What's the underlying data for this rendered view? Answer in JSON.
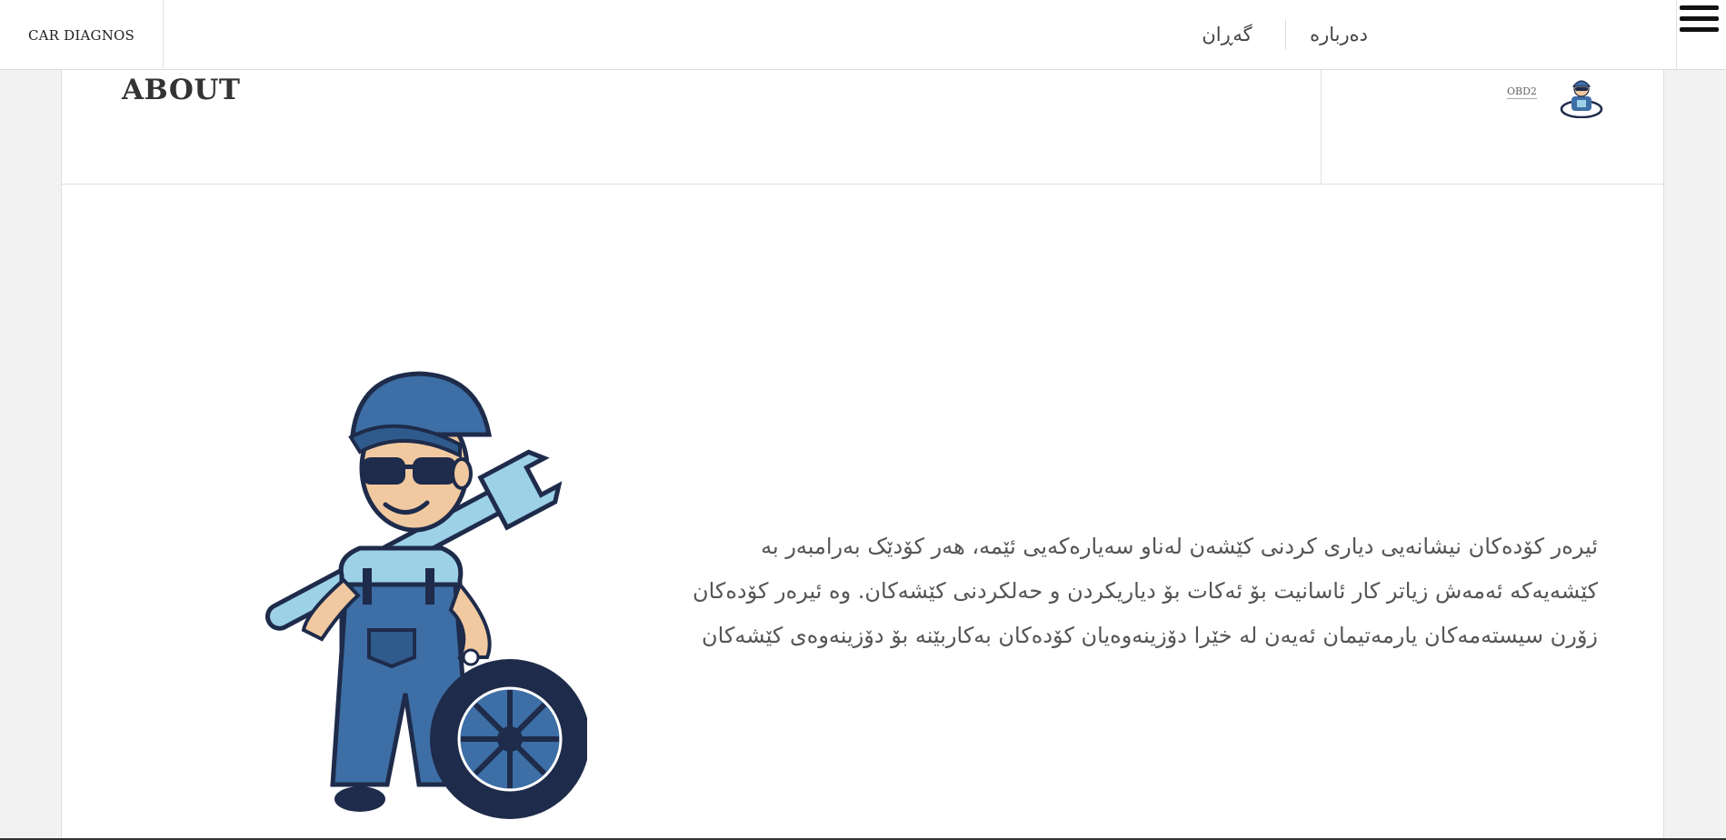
{
  "header": {
    "brand": "CAR DIAGNOS",
    "nav": [
      {
        "label": "دەربارە"
      },
      {
        "label": "گەڕان"
      }
    ],
    "menu_icon": "hamburger-icon"
  },
  "page": {
    "title": "ABOUT",
    "author_link": "OBD2",
    "avatar_icon": "mechanic-avatar",
    "illustration": "mechanic-mascot",
    "body_text": "ئیرەر کۆدەکان نیشانەیی دیاری کردنی کێشەن لەناو سەیارەکەیی ئێمە، هەر کۆدێک بەرامبەر بە کێشەیەکە ئەمەش زیاتر کار ئاسانیت بۆ ئەکات بۆ دیاریکردن و حەلکردنی کێشەکان. وە ئیرەر کۆدەکان زۆرن سیستەمەکان یارمەتیمان ئەیەن لە خێرا دۆزینەوەیان کۆدەکان بەکاربێنە بۆ دۆزینەوەی کێشەکان"
  },
  "colors": {
    "background": "#f2f2f2",
    "card": "#ffffff",
    "text": "#333333",
    "mascot_blue": "#3d6ea5",
    "mascot_navy": "#1e2b4a"
  }
}
